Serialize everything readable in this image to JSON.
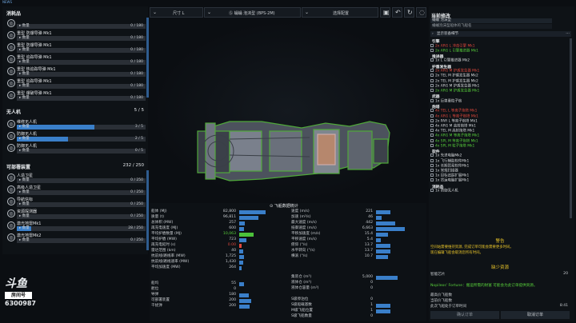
{
  "top_tag": "NEWS",
  "left_panel": {
    "category_consumables": "消耗品",
    "category_drones": "无人机",
    "drones_count": "5 / 5",
    "category_deployables": "可部署装置",
    "deployables_count": "232 / 250",
    "items": [
      {
        "title": "",
        "sub": "数量",
        "count": "0 / 180",
        "fill": 0
      },
      {
        "title": "重型 防爆导弹 Mk1",
        "sub": "数量",
        "count": "0 / 180",
        "fill": 0
      },
      {
        "title": "重型 防爆导弹 Mk1",
        "sub": "数量",
        "count": "0 / 180",
        "fill": 0
      },
      {
        "title": "重型 追踪导弹 Mk1",
        "sub": "数量",
        "count": "0 / 180",
        "fill": 0
      },
      {
        "title": "重型 热追踪导弹 Mk1",
        "sub": "数量",
        "count": "0 / 180",
        "fill": 0
      },
      {
        "title": "重型 追踪导弹 Mk1",
        "sub": "数量",
        "count": "0 / 180",
        "fill": 0
      },
      {
        "title": "重型 爆破导弹 Mk1",
        "sub": "数量",
        "count": "0 / 180",
        "fill": 0
      }
    ],
    "drone_items": [
      {
        "title": "维修无人机",
        "sub": "数量",
        "count": "3 / 5",
        "fill": 0.6
      },
      {
        "title": "防御无人机",
        "sub": "数量",
        "count": "2 / 5",
        "fill": 0.4
      },
      {
        "title": "防御无人机",
        "sub": "数量",
        "count": "0 / 5",
        "fill": 0
      }
    ],
    "deploy_items": [
      {
        "title": "人造卫星",
        "sub": "数量",
        "count": "0 / 250",
        "fill": 0
      },
      {
        "title": "高级人造卫星",
        "sub": "数量",
        "count": "0 / 250",
        "fill": 0
      },
      {
        "title": "导航信标",
        "sub": "数量",
        "count": "0 / 250",
        "fill": 0
      },
      {
        "title": "资源探测器",
        "sub": "数量",
        "count": "0 / 250",
        "fill": 0
      },
      {
        "title": "激光地雷Mk1",
        "sub": "数量",
        "count": "28 / 250",
        "fill": 0.11
      },
      {
        "title": "激光地雷Mk2",
        "sub": "数量",
        "count": "0 / 250",
        "fill": 0
      }
    ]
  },
  "toolbar": {
    "size_label": "尺寸 L",
    "ship_label": "Ⓢ 蛹蛹 泡沫型 (BPS-2M)",
    "config_label": "选择配置"
  },
  "stats_title": "飞船数据统计",
  "stats_left": [
    {
      "label": "船体 (MJ)",
      "value": "82,800",
      "fill": 0.55,
      "color": "blue"
    },
    {
      "label": "质量 (t)",
      "value": "96,811",
      "fill": 0.4,
      "color": "blue"
    },
    {
      "label": "总体积 (MW)",
      "value": "257",
      "fill": 0.12,
      "color": "blue"
    },
    {
      "label": "再充电速度 (MJ)",
      "value": "600",
      "fill": 0.1,
      "color": "blue"
    },
    {
      "label": "平均护盾数量 (MJ)",
      "value": "10,063",
      "fill": 0.3,
      "color": "green"
    },
    {
      "label": "平均护盾 (MW)",
      "value": "723",
      "fill": 0.15,
      "color": "blue"
    },
    {
      "label": "再充电延时 (s)",
      "value": "0.00",
      "fill": 0.05,
      "color": "red"
    },
    {
      "label": "雷达范围 (km)",
      "value": "40",
      "fill": 0.08,
      "color": "blue"
    },
    {
      "label": "抗前线/路线率 (MW)",
      "value": "1,725",
      "fill": 0.1,
      "color": "blue"
    },
    {
      "label": "抗前线/路线速率 (MW)",
      "value": "1,430",
      "fill": 0.09,
      "color": "blue"
    },
    {
      "label": "平均加速度 (MW)",
      "value": "264",
      "fill": 0.05,
      "color": "blue"
    }
  ],
  "stats_left2": [
    {
      "label": "船坞",
      "value": "55",
      "fill": 0.1
    },
    {
      "label": "舱位",
      "value": "0",
      "fill": 0
    },
    {
      "label": "导弹",
      "value": "180",
      "fill": 0.2
    },
    {
      "label": "可部署装置",
      "value": "200",
      "fill": 0.25
    },
    {
      "label": "干扰弹",
      "value": "200",
      "fill": 0.22
    }
  ],
  "stats_right": [
    {
      "label": "速度 (m/s)",
      "value": "221",
      "fill": 0.3
    },
    {
      "label": "加速 (m²/s)",
      "value": "46",
      "fill": 0.12
    },
    {
      "label": "最大速度 (m/s)",
      "value": "442",
      "fill": 0.4
    },
    {
      "label": "抵御速度 (m/s)",
      "value": "6,663",
      "fill": 0.6
    },
    {
      "label": "平移加速度 (m/s)",
      "value": "15.4",
      "fill": 0.25
    },
    {
      "label": "平移速度 (m/s)",
      "value": "5.4",
      "fill": 0.1
    },
    {
      "label": "俯仰 (°/s)",
      "value": "13.7",
      "fill": 0.3
    },
    {
      "label": "水平转向 (°/s)",
      "value": "13.7",
      "fill": 0.3
    },
    {
      "label": "横滚 (°/s)",
      "value": "10.7",
      "fill": 0.25
    }
  ],
  "stats_right2": [
    {
      "label": "集装仓 (m³)",
      "value": "5,000",
      "fill": 0.45
    },
    {
      "label": "液体仓 (m³)",
      "value": "0",
      "fill": 0
    },
    {
      "label": "液体仓容量 (m³)",
      "value": "0",
      "fill": 0
    },
    {
      "label": "",
      "value": "",
      "fill": 0
    },
    {
      "label": "S级停泊位",
      "value": "0",
      "fill": 0
    },
    {
      "label": "S级船载基数",
      "value": "1",
      "fill": 0.3
    },
    {
      "label": "M级飞船位置",
      "value": "1",
      "fill": 0.3
    },
    {
      "label": "S级飞船数量",
      "value": "0",
      "fill": 0
    }
  ],
  "right_panel": {
    "title": "当前修改",
    "ship_name": "蛹蛹 泡沫型",
    "input_placeholder": "蛹蛹泡沫型船体的飞船名",
    "detail_button": "显示装备细节",
    "sections": [
      {
        "header": "引擎",
        "items": [
          {
            "text": "2x ARG L 冲击引擎 Mk1",
            "color": "red"
          },
          {
            "text": "2x ARG L 引擎推进器 Mk1",
            "color": "green"
          }
        ]
      },
      {
        "header": "推进器",
        "items": [
          {
            "text": "1x L 引擎推进器 Mk2",
            "color": "white"
          }
        ]
      },
      {
        "header": "护盾发生器",
        "items": [
          {
            "text": "2x ARG M 护盾发生器 Mk1",
            "color": "red"
          },
          {
            "text": "2x TEL M 护盾发生器 Mk2",
            "color": "white"
          },
          {
            "text": "2x TEL M 护盾发生器 Mk2",
            "color": "white"
          },
          {
            "text": "2x ARG M 护盾发生器 Mk1",
            "color": "white"
          },
          {
            "text": "2x ARG M 护盾发生器 Mk1",
            "color": "green"
          }
        ]
      },
      {
        "header": "武器",
        "items": [
          {
            "text": "1x 巨兽重粒子炮",
            "color": "white"
          }
        ]
      },
      {
        "header": "炮塔",
        "items": [
          {
            "text": "4x TEL L 等离子炮塔 Mk1",
            "color": "red"
          },
          {
            "text": "4x ARG L 等离子炮塔 Mk1",
            "color": "red"
          },
          {
            "text": "2x PAR L 等离子炮塔 Mk1",
            "color": "white"
          },
          {
            "text": "4x ARG M 高射炮塔 Mk1",
            "color": "white"
          },
          {
            "text": "4x TEL M 高射炮塔 Mk1",
            "color": "white"
          },
          {
            "text": "4x ARG M 等离子炮塔 Mk1",
            "color": "green"
          },
          {
            "text": "4x SPL M 等离子炮塔 Mk1",
            "color": "green"
          },
          {
            "text": "4x SPL M 粒子炮塔 Mk1",
            "color": "green"
          }
        ]
      },
      {
        "header": "软件",
        "items": [
          {
            "text": "1x 先进电脑Mk2",
            "color": "white"
          },
          {
            "text": "1x 飞行辅助软件Mk1",
            "color": "white"
          },
          {
            "text": "1x 长期贸易软件Mk1",
            "color": "white"
          },
          {
            "text": "1x 常规扫描器",
            "color": "white"
          },
          {
            "text": "1x 目标追踪扩展Mk1",
            "color": "white"
          },
          {
            "text": "1x 货运电脑扩展Mk1",
            "color": "white"
          }
        ]
      },
      {
        "header": "消耗品",
        "items": [
          {
            "text": "1x 防御无人机",
            "color": "white"
          }
        ]
      }
    ],
    "warning_title": "警告",
    "warning_text": "空间站需要维持资源, 完成订单可能会需要更多时间。",
    "warning_text2": "现在编辑飞船会取消您所有时间。",
    "missing_title": "缺少资源",
    "missing_row_label": "智能芯片",
    "missing_row_value": "20",
    "notice": "Nopileos' Fortune：搬运所需的财富  可能会为此订单提供资源。",
    "cost_rows": [
      {
        "label": "最高价飞船数",
        "value": ""
      },
      {
        "label": "当前价飞船数",
        "value": ""
      },
      {
        "label": "此次飞船处于订单时间",
        "value": "8:41"
      }
    ],
    "confirm_button": "确认订单",
    "cancel_button": "取消订单"
  },
  "watermark": {
    "line1": "斗鱼",
    "line2": "房间号",
    "room": "6300987"
  },
  "colors": {
    "accent_blue": "#3a7fc9",
    "accent_green": "#4cc13a",
    "warning_yellow": "#e6c229",
    "error_red": "#e0483c"
  }
}
